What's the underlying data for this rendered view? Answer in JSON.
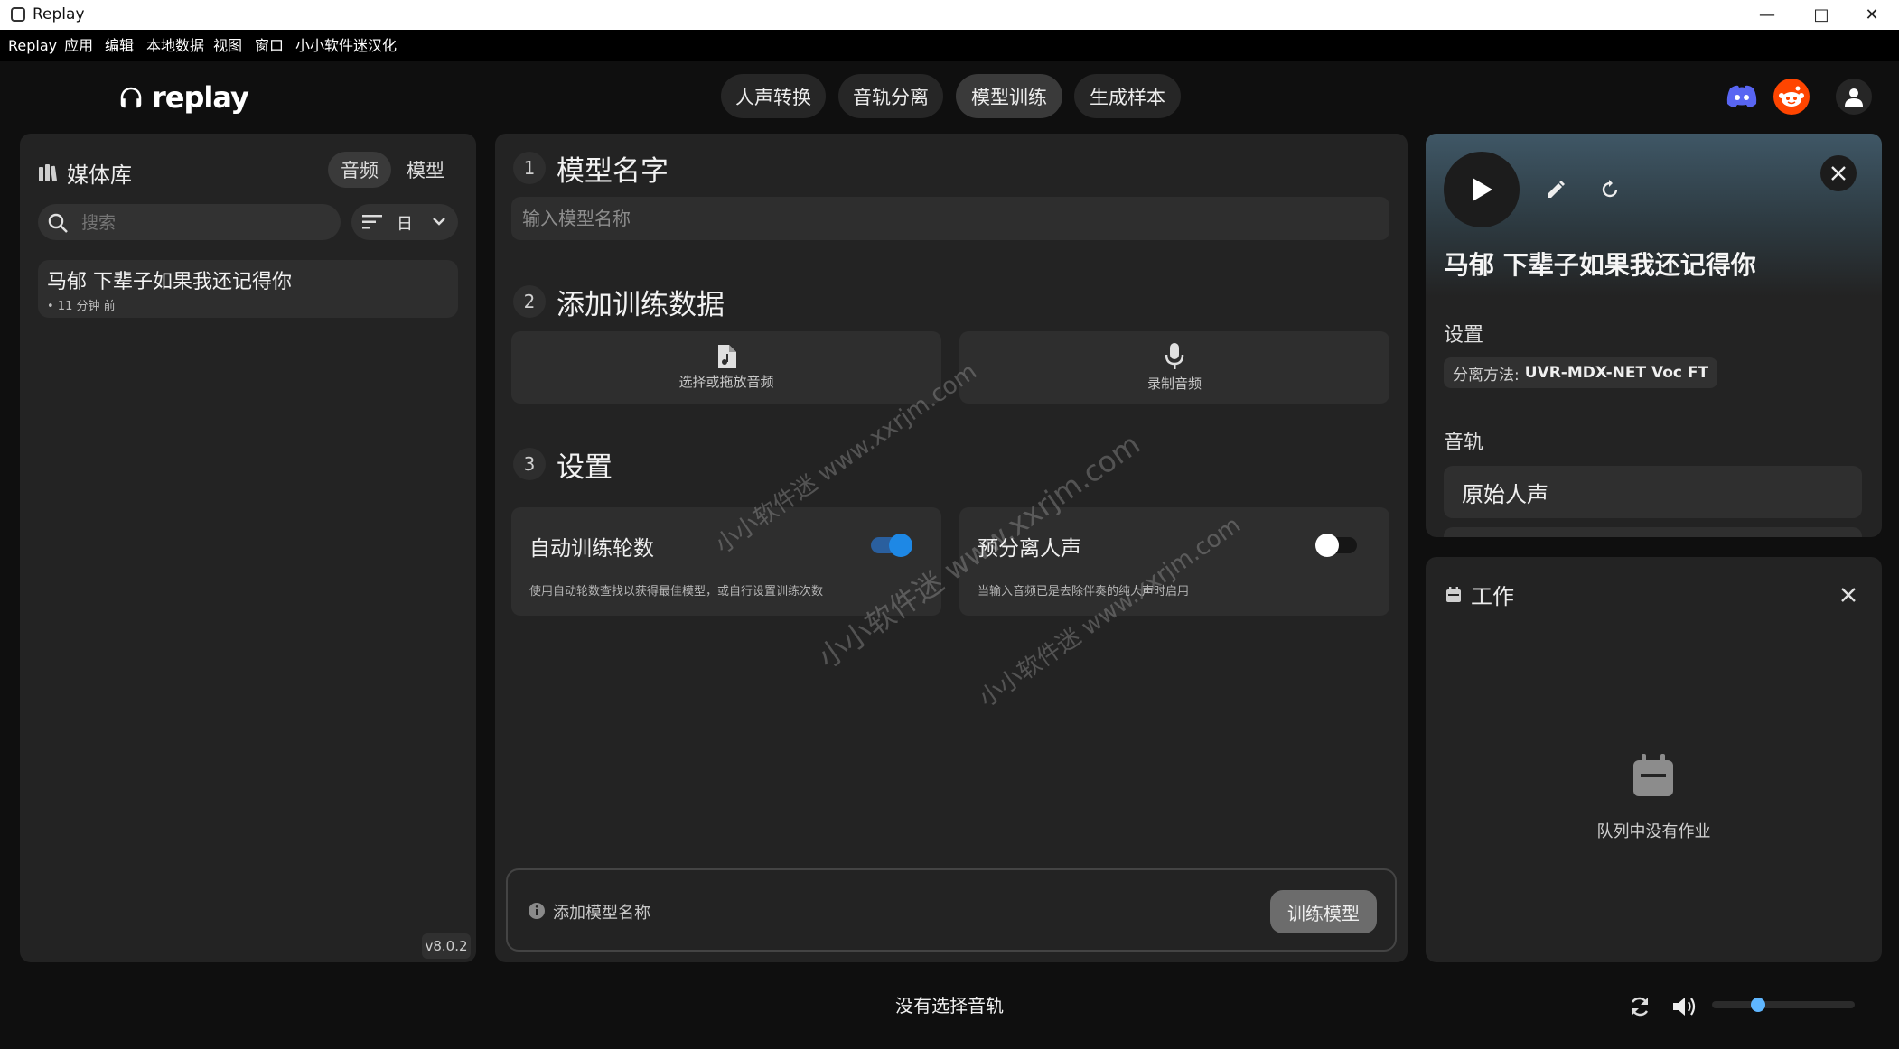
{
  "window": {
    "title": "Replay"
  },
  "menu": [
    "Replay",
    "应用",
    "编辑",
    "本地数据",
    "视图",
    "窗口",
    "小小软件迷汉化"
  ],
  "logo": "replay",
  "nav": [
    {
      "label": "人声转换",
      "active": false
    },
    {
      "label": "音轨分离",
      "active": false
    },
    {
      "label": "模型训练",
      "active": true
    },
    {
      "label": "生成样本",
      "active": false
    }
  ],
  "header_icons": [
    "discord-icon",
    "reddit-icon",
    "user-icon"
  ],
  "library": {
    "title": "媒体库",
    "tabs": [
      {
        "label": "音频",
        "active": true
      },
      {
        "label": "模型",
        "active": false
      }
    ],
    "search_placeholder": "搜索",
    "sort_value": "日",
    "items": [
      {
        "title": "马郁 下辈子如果我还记得你",
        "time": "• 11 分钟 前"
      }
    ],
    "version": "v8.0.2"
  },
  "training": {
    "step1": {
      "num": "1",
      "title": "模型名字",
      "placeholder": "输入模型名称",
      "value": ""
    },
    "step2": {
      "num": "2",
      "title": "添加训练数据",
      "select_audio": "选择或拖放音频",
      "record_audio": "录制音频"
    },
    "step3": {
      "num": "3",
      "title": "设置"
    },
    "auto_epochs": {
      "title": "自动训练轮数",
      "desc": "使用自动轮数查找以获得最佳模型，或自行设置训练次数",
      "enabled": true
    },
    "pre_separate": {
      "title": "预分离人声",
      "desc": "当输入音频已是去除伴奏的纯人声时启用",
      "enabled": false
    },
    "hint": "添加模型名称",
    "train_button": "训练模型"
  },
  "detail": {
    "title": "马郁 下辈子如果我还记得你",
    "settings_label": "设置",
    "separation_key": "分离方法:",
    "separation_value": "UVR-MDX-NET Voc FT",
    "tracks_label": "音轨",
    "track_name": "原始人声"
  },
  "jobs": {
    "title": "工作",
    "empty": "队列中没有作业"
  },
  "player": {
    "status": "没有选择音轨",
    "volume": 0.3
  },
  "watermark": [
    "小小软件迷 www.xxrjm.com",
    "小小软件迷 www.xxrjm.com",
    "小小软件迷 www.xxrjm.com"
  ],
  "colors": {
    "accent": "#1e88e5",
    "volume": "#5fb6ff",
    "discord": "#5865f2",
    "reddit": "#ff4500"
  }
}
